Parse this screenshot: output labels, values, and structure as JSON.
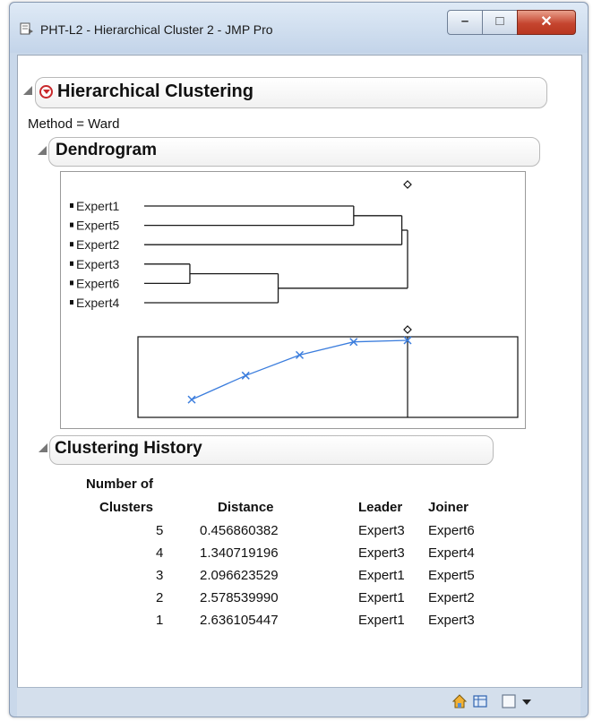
{
  "window": {
    "title": "PHT-L2 - Hierarchical Cluster 2 - JMP Pro",
    "minimize_glyph": "–",
    "maximize_glyph": "□",
    "close_glyph": "✕"
  },
  "report": {
    "title": "Hierarchical Clustering",
    "method": "Method = Ward"
  },
  "dendrogram": {
    "title": "Dendrogram",
    "labels": [
      "Expert1",
      "Expert5",
      "Expert2",
      "Expert3",
      "Expert6",
      "Expert4"
    ],
    "merges": [
      {
        "clusters": 5,
        "distance": 0.456860382,
        "leader": "Expert3",
        "joiner": "Expert6"
      },
      {
        "clusters": 4,
        "distance": 1.340719196,
        "leader": "Expert3",
        "joiner": "Expert4"
      },
      {
        "clusters": 3,
        "distance": 2.096623529,
        "leader": "Expert1",
        "joiner": "Expert5"
      },
      {
        "clusters": 2,
        "distance": 2.57853999,
        "leader": "Expert1",
        "joiner": "Expert2"
      },
      {
        "clusters": 1,
        "distance": 2.636105447,
        "leader": "Expert1",
        "joiner": "Expert3"
      }
    ],
    "line_color": "#1a1a1a",
    "scree_color": "#3b7ddd"
  },
  "history": {
    "title": "Clustering History",
    "col_number_line1": "Number of",
    "col_number_line2": "Clusters",
    "col_distance": "Distance",
    "col_leader": "Leader",
    "col_joiner": "Joiner",
    "rows": [
      {
        "clusters": "5",
        "distance": "0.456860382",
        "leader": "Expert3",
        "joiner": "Expert6"
      },
      {
        "clusters": "4",
        "distance": "1.340719196",
        "leader": "Expert3",
        "joiner": "Expert4"
      },
      {
        "clusters": "3",
        "distance": "2.096623529",
        "leader": "Expert1",
        "joiner": "Expert5"
      },
      {
        "clusters": "2",
        "distance": "2.578539990",
        "leader": "Expert1",
        "joiner": "Expert2"
      },
      {
        "clusters": "1",
        "distance": "2.636105447",
        "leader": "Expert1",
        "joiner": "Expert3"
      }
    ]
  },
  "statusbar": {
    "icons": [
      "home-icon",
      "table-icon",
      "checkbox-icon",
      "dropdown-arrow-icon"
    ]
  }
}
